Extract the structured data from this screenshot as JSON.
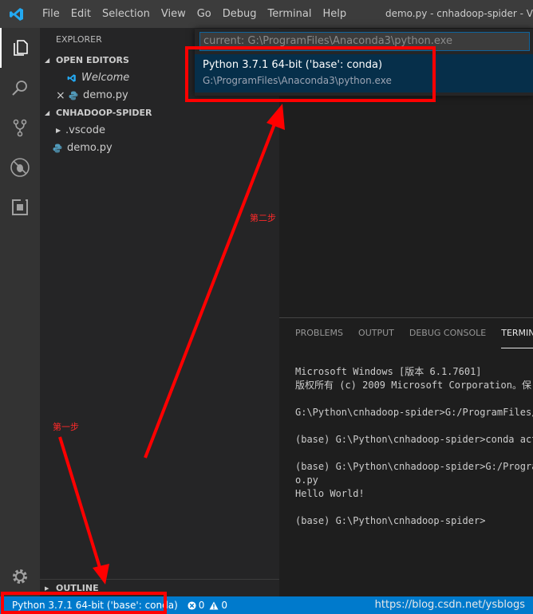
{
  "titlebar": {
    "menu": [
      "File",
      "Edit",
      "Selection",
      "View",
      "Go",
      "Debug",
      "Terminal",
      "Help"
    ],
    "window_title": "demo.py - cnhadoop-spider - V"
  },
  "sidebar": {
    "title": "EXPLORER",
    "open_editors": {
      "label": "OPEN EDITORS",
      "items": [
        {
          "label": "Welcome",
          "icon": "vscode-icon"
        },
        {
          "label": "demo.py",
          "icon": "python-icon",
          "close": "×"
        }
      ]
    },
    "project": {
      "label": "CNHADOOP-SPIDER",
      "items": [
        {
          "label": ".vscode"
        },
        {
          "label": "demo.py"
        }
      ]
    },
    "outline_label": "OUTLINE"
  },
  "quick_pick": {
    "input_value": "current: G:\\ProgramFiles\\Anaconda3\\python.exe",
    "item_label": "Python 3.7.1 64-bit ('base': conda)",
    "item_detail": "G:\\ProgramFiles\\Anaconda3\\python.exe"
  },
  "panel": {
    "tabs": [
      "PROBLEMS",
      "OUTPUT",
      "DEBUG CONSOLE",
      "TERMINAL"
    ],
    "active_tab": "TERMINAL",
    "terminal_lines": [
      "Microsoft Windows [版本 6.1.7601]",
      "版权所有 (c) 2009 Microsoft Corporation。保",
      "",
      "G:\\Python\\cnhadoop-spider>G:/ProgramFiles/A",
      "",
      "(base) G:\\Python\\cnhadoop-spider>conda acti",
      "",
      "(base) G:\\Python\\cnhadoop-spider>G:/Program",
      "o.py",
      "Hello World!",
      "",
      "(base) G:\\Python\\cnhadoop-spider>"
    ]
  },
  "statusbar": {
    "interpreter": "Python 3.7.1 64-bit ('base': conda)",
    "errors": "0",
    "warnings": "0"
  },
  "annotations": {
    "step1": "第一步",
    "step2": "第二步"
  },
  "watermark": "https://blog.csdn.net/ysblogs",
  "colors": {
    "accent": "#007acc",
    "annotation_red": "#ff0000",
    "selection": "#062f4a"
  }
}
